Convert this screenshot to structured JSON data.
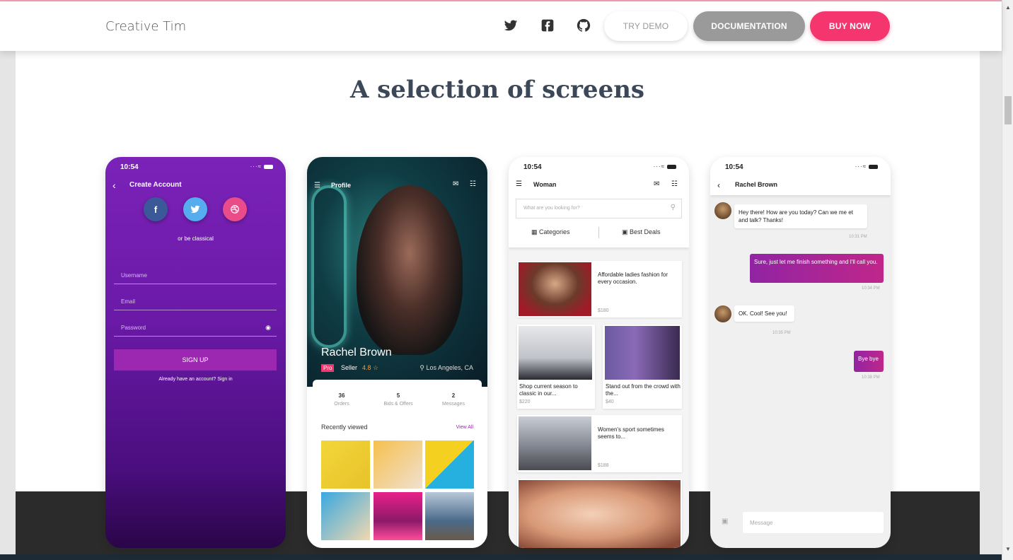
{
  "navbar": {
    "brand": "Creative Tim",
    "icons": [
      "twitter-icon",
      "facebook-icon",
      "github-icon"
    ],
    "try_demo": "TRY DEMO",
    "documentation": "DOCUMENTATION",
    "buy_now": "BUY NOW",
    "accent": "#f5356e"
  },
  "section": {
    "title": "A selection of screens"
  },
  "phone1": {
    "time": "10:54",
    "header": "Create Account",
    "or_text": "or be classical",
    "fields": {
      "username": "Username",
      "email": "Email",
      "password": "Password"
    },
    "signup": "SIGN UP",
    "already": "Already have an account? Sign in"
  },
  "phone2": {
    "title": "Profile",
    "name": "Rachel Brown",
    "badge": "Pro",
    "role": "Seller",
    "rating": "4.8",
    "location": "Los Angeles, CA",
    "stats": [
      {
        "value": "36",
        "label": "Orders"
      },
      {
        "value": "5",
        "label": "Bids & Offers"
      },
      {
        "value": "2",
        "label": "Messages"
      }
    ],
    "recent": "Recently viewed",
    "view_all": "View All"
  },
  "phone3": {
    "time": "10:54",
    "title": "Woman",
    "search_placeholder": "What are you looking for?",
    "tabs": [
      "Categories",
      "Best Deals"
    ],
    "products": [
      {
        "text": "Affordable ladies fashion for every occasion.",
        "price": "$180"
      },
      {
        "text": "Shop current season to classic in our...",
        "price": "$220"
      },
      {
        "text": "Stand out from the crowd with the...",
        "price": "$40"
      },
      {
        "text": "Women's sport sometimes seems to...",
        "price": "$188"
      }
    ]
  },
  "phone4": {
    "time": "10:54",
    "title": "Rachel Brown",
    "messages": [
      {
        "text": "Hey there! How are you today? Can we me et and talk? Thanks!",
        "time": "10:31 PM"
      },
      {
        "text": "Sure, just let me finish something and I'll call you.",
        "time": "10:34 PM"
      },
      {
        "text": "OK. Cool! See you!",
        "time": "10:35 PM"
      },
      {
        "text": "Bye bye",
        "time": "10:38 PM"
      }
    ],
    "input_placeholder": "Message"
  }
}
